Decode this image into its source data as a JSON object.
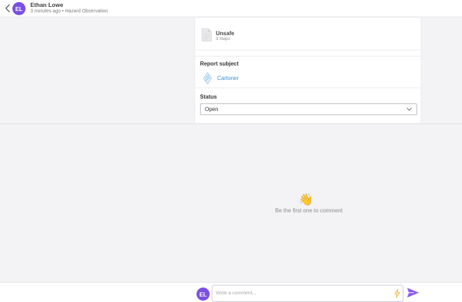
{
  "header": {
    "avatar_initials": "EL",
    "user_name": "Ethan Lowe",
    "subtitle": "3 minutes ago • Hazard Observation",
    "back_icon": "chevron-left-icon"
  },
  "step": {
    "title": "Unsafe",
    "count": "3 Steps",
    "icon": "document-icon"
  },
  "subject": {
    "label": "Report subject",
    "value": "Cartoner",
    "icon": "diamond-logo-icon"
  },
  "status": {
    "label": "Status",
    "selected": "Open"
  },
  "comments": {
    "empty_emoji": "👋",
    "empty_text": "Be the first one to comment"
  },
  "composer": {
    "avatar_initials": "EL",
    "placeholder": "Write a comment...",
    "quick_icon": "lightning-icon",
    "send_icon": "send-icon"
  },
  "colors": {
    "accent": "#7a4fe3",
    "link": "#2e8fd1",
    "bolt": "#f0b429",
    "send": "#8a5cf5"
  }
}
